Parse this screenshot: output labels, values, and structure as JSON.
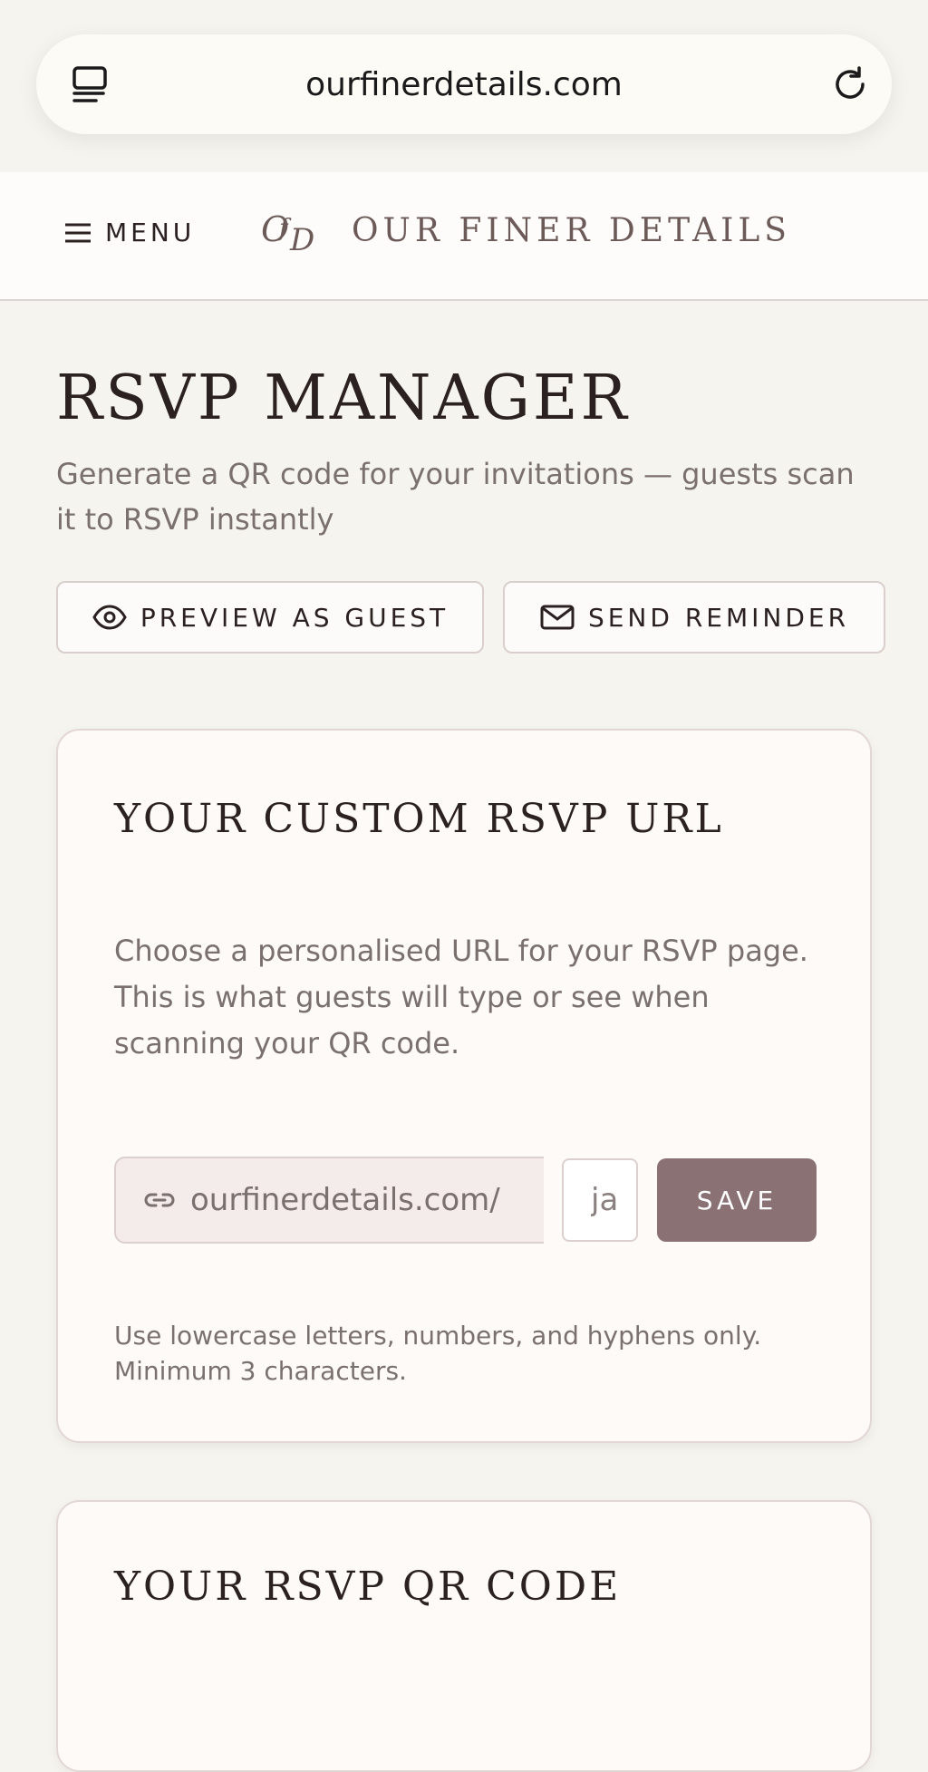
{
  "browser": {
    "url": "ourfinerdetails.com",
    "icons": {
      "left": "tabs-icon",
      "right": "reload-icon"
    }
  },
  "header": {
    "menu_label": "MENU",
    "brand_name": "OUR FINER DETAILS",
    "monogram": "OfD"
  },
  "page": {
    "title": "RSVP MANAGER",
    "subtitle": "Generate a QR code for your invitations — guests scan it to RSVP instantly",
    "actions": {
      "preview_label": "PREVIEW AS GUEST",
      "reminder_label": "SEND REMINDER"
    }
  },
  "url_card": {
    "title": "YOUR CUSTOM RSVP URL",
    "description": "Choose a personalised URL for your RSVP page. This is what guests will type or see when scanning your QR code.",
    "prefix": "ourfinerdetails.com/",
    "slug_value": "ja",
    "save_label": "SAVE",
    "hint": "Use lowercase letters, numbers, and hyphens only. Minimum 3 characters."
  },
  "qr_card": {
    "title": "YOUR RSVP QR CODE"
  },
  "colors": {
    "background": "#f6f4ee",
    "accent": "#8a7274",
    "text": "#2b2120",
    "muted": "#7a706e"
  }
}
